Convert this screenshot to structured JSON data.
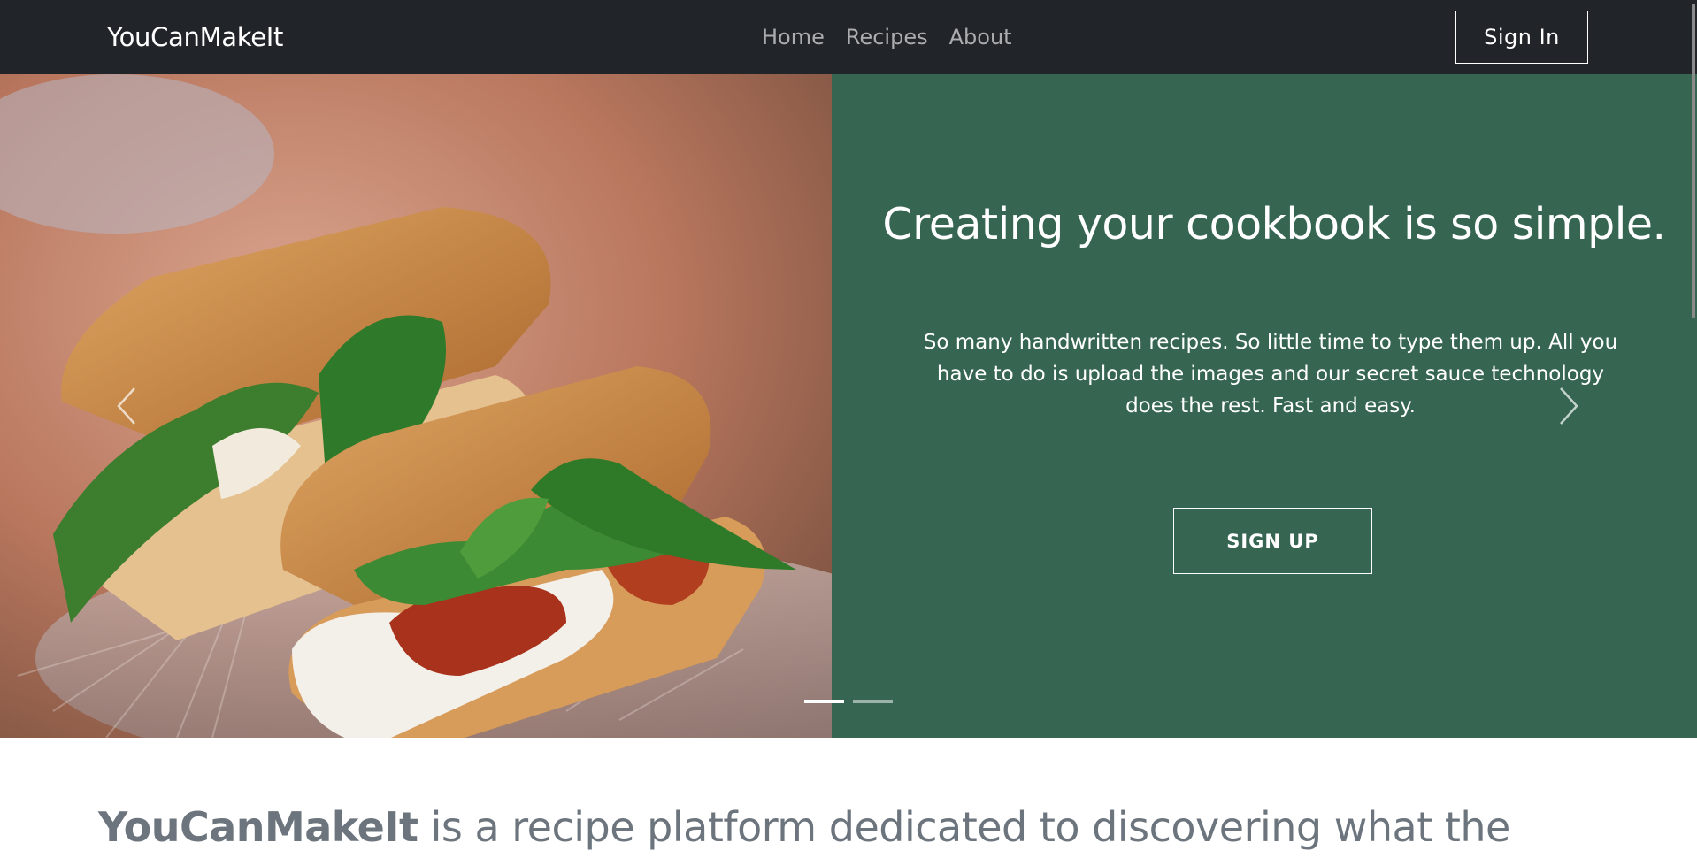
{
  "navbar": {
    "brand": "YouCanMakeIt",
    "links": [
      {
        "label": "Home"
      },
      {
        "label": "Recipes"
      },
      {
        "label": "About"
      }
    ],
    "sign_in_label": "Sign In"
  },
  "hero": {
    "title": "Creating your cookbook is so simple.",
    "text": "So many handwritten recipes. So little time to type them up. All you have to do is upload the images and our secret sauce technology does the rest. Fast and easy.",
    "signup_label": "SIGN UP",
    "panel_color": "#366652",
    "image_description_icon": "sandwich-photo",
    "slides_count": 2,
    "active_slide": 1
  },
  "about": {
    "brand": "YouCanMakeIt",
    "text": " is a recipe platform dedicated to discovering what the"
  },
  "colors": {
    "navbar_bg": "#212529",
    "accent_green": "#366652",
    "muted_text": "#6c757d"
  }
}
